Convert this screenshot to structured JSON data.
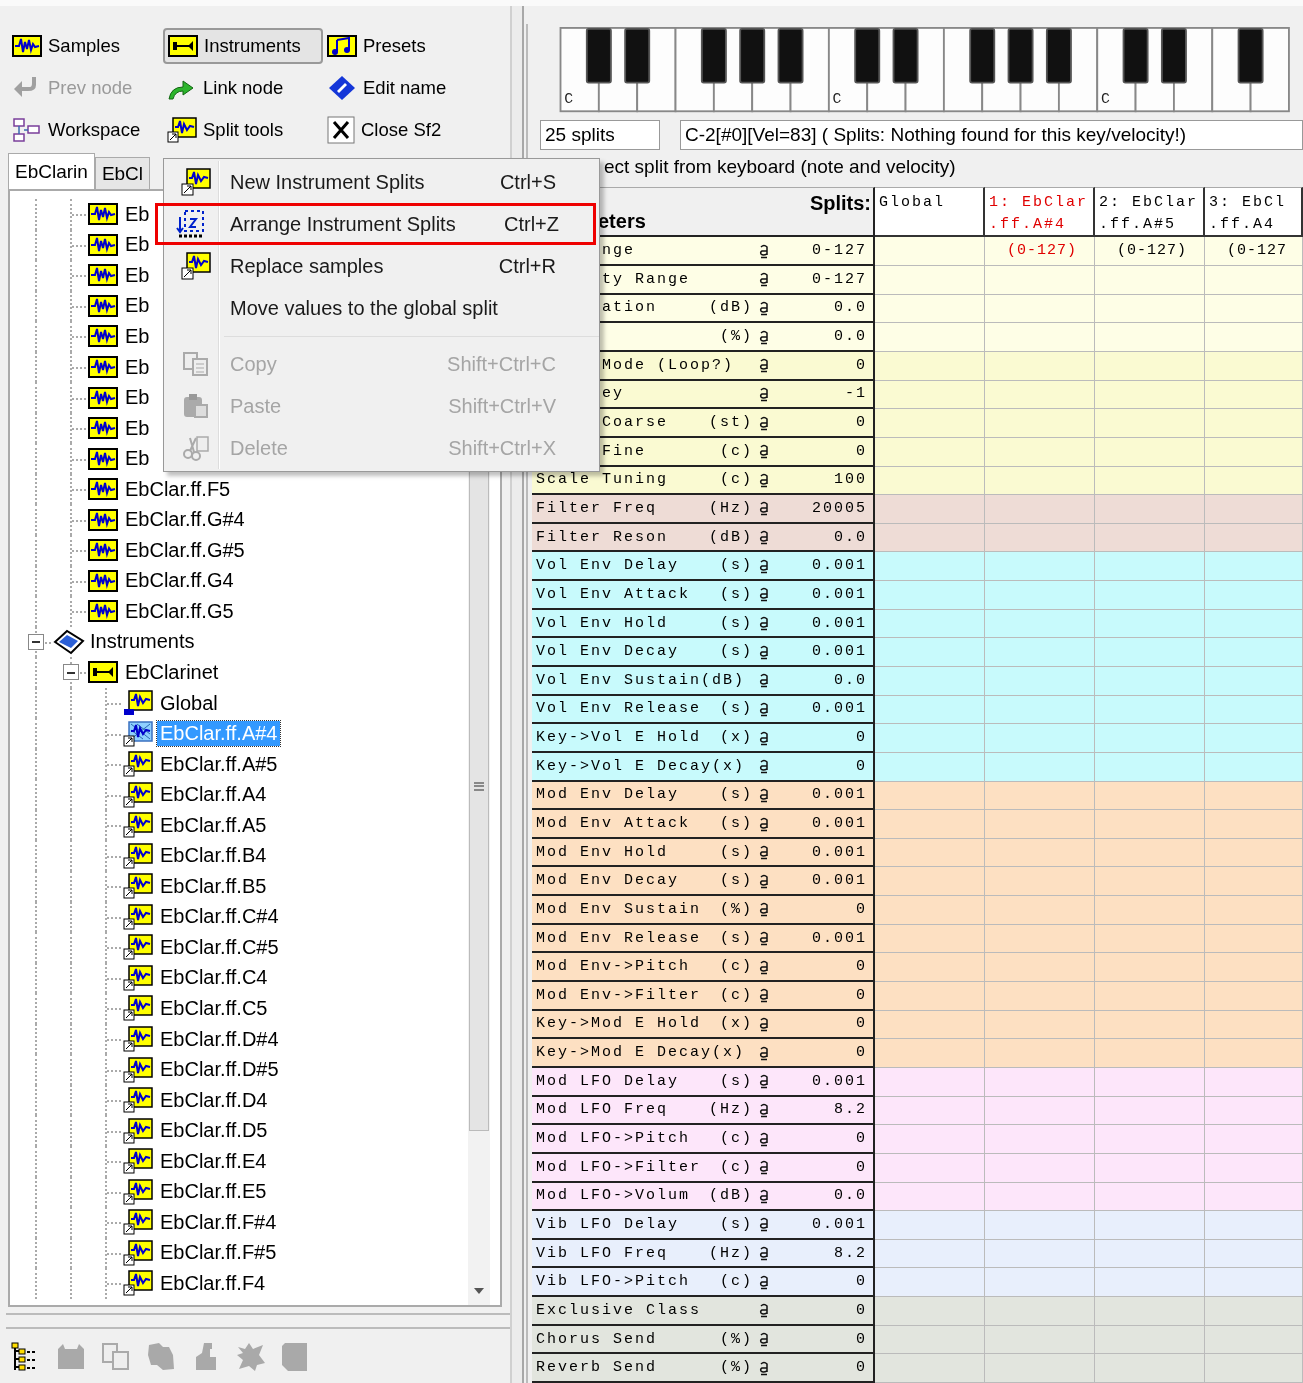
{
  "toolbar": [
    {
      "label": "Samples",
      "kind": "samples",
      "selected": false,
      "disabled": false
    },
    {
      "label": "Instruments",
      "kind": "instruments",
      "selected": true,
      "disabled": false
    },
    {
      "label": "Presets",
      "kind": "presets",
      "selected": false,
      "disabled": false
    },
    {
      "label": "Prev node",
      "kind": "prev",
      "selected": false,
      "disabled": true
    },
    {
      "label": "Link node",
      "kind": "link",
      "selected": false,
      "disabled": false
    },
    {
      "label": "Edit name",
      "kind": "edit",
      "selected": false,
      "disabled": false
    },
    {
      "label": "Workspace",
      "kind": "workspace",
      "selected": false,
      "disabled": false
    },
    {
      "label": "Split tools",
      "kind": "splittools",
      "selected": false,
      "disabled": false
    },
    {
      "label": "Close Sf2",
      "kind": "close",
      "selected": false,
      "disabled": false
    }
  ],
  "tabs": [
    {
      "label": "EbClarin",
      "selected": true
    },
    {
      "label": "EbCl",
      "selected": false
    }
  ],
  "tree": {
    "sample_rows": [
      {
        "label": "Eb",
        "kind": "sample",
        "selected": false
      },
      {
        "label": "Eb",
        "kind": "sample",
        "selected": false
      },
      {
        "label": "Eb",
        "kind": "sample",
        "selected": false
      },
      {
        "label": "Eb",
        "kind": "sample",
        "selected": false
      },
      {
        "label": "Eb",
        "kind": "sample",
        "selected": false
      },
      {
        "label": "Eb",
        "kind": "sample",
        "selected": false
      },
      {
        "label": "Eb",
        "kind": "sample",
        "selected": false
      },
      {
        "label": "Eb",
        "kind": "sample",
        "selected": false
      },
      {
        "label": "Eb",
        "kind": "sample",
        "selected": false
      },
      {
        "label": "EbClar.ff.F5",
        "kind": "sample",
        "selected": false
      },
      {
        "label": "EbClar.ff.G#4",
        "kind": "sample",
        "selected": false
      },
      {
        "label": "EbClar.ff.G#5",
        "kind": "sample",
        "selected": false
      },
      {
        "label": "EbClar.ff.G4",
        "kind": "sample",
        "selected": false
      },
      {
        "label": "EbClar.ff.G5",
        "kind": "sample",
        "selected": false
      }
    ],
    "nodes": [
      {
        "label": "Instruments",
        "kind": "instruments",
        "selected": false,
        "expanded": true,
        "children": [
          {
            "label": "EbClarinet",
            "kind": "instrument",
            "selected": false,
            "expanded": true,
            "children": [
              {
                "label": "Global",
                "kind": "global",
                "selected": false
              },
              {
                "label": "EbClar.ff.A#4",
                "kind": "split",
                "selected": true
              },
              {
                "label": "EbClar.ff.A#5",
                "kind": "split",
                "selected": false
              },
              {
                "label": "EbClar.ff.A4",
                "kind": "split",
                "selected": false
              },
              {
                "label": "EbClar.ff.A5",
                "kind": "split",
                "selected": false
              },
              {
                "label": "EbClar.ff.B4",
                "kind": "split",
                "selected": false
              },
              {
                "label": "EbClar.ff.B5",
                "kind": "split",
                "selected": false
              },
              {
                "label": "EbClar.ff.C#4",
                "kind": "split",
                "selected": false
              },
              {
                "label": "EbClar.ff.C#5",
                "kind": "split",
                "selected": false
              },
              {
                "label": "EbClar.ff.C4",
                "kind": "split",
                "selected": false
              },
              {
                "label": "EbClar.ff.C5",
                "kind": "split",
                "selected": false
              },
              {
                "label": "EbClar.ff.D#4",
                "kind": "split",
                "selected": false
              },
              {
                "label": "EbClar.ff.D#5",
                "kind": "split",
                "selected": false
              },
              {
                "label": "EbClar.ff.D4",
                "kind": "split",
                "selected": false
              },
              {
                "label": "EbClar.ff.D5",
                "kind": "split",
                "selected": false
              },
              {
                "label": "EbClar.ff.E4",
                "kind": "split",
                "selected": false
              },
              {
                "label": "EbClar.ff.E5",
                "kind": "split",
                "selected": false
              },
              {
                "label": "EbClar.ff.F#4",
                "kind": "split",
                "selected": false
              },
              {
                "label": "EbClar.ff.F#5",
                "kind": "split",
                "selected": false
              },
              {
                "label": "EbClar.ff.F4",
                "kind": "split",
                "selected": false
              }
            ]
          }
        ]
      }
    ]
  },
  "bottom_toolbar": [
    {
      "kind": "tree",
      "disabled": false
    },
    {
      "kind": "bin",
      "disabled": true
    },
    {
      "kind": "copy",
      "disabled": true
    },
    {
      "kind": "stack",
      "disabled": true
    },
    {
      "kind": "boot",
      "disabled": true
    },
    {
      "kind": "splat",
      "disabled": true
    },
    {
      "kind": "page",
      "disabled": true
    }
  ],
  "context_menu": {
    "items": [
      {
        "kind": "new-splits",
        "label": "New Instrument Splits",
        "shortcut": "Ctrl+S",
        "disabled": false,
        "highlighted": false
      },
      {
        "kind": "arrange",
        "label": "Arrange Instrument Splits",
        "shortcut": "Ctrl+Z",
        "disabled": false,
        "highlighted": true
      },
      {
        "kind": "replace",
        "label": "Replace samples",
        "shortcut": "Ctrl+R",
        "disabled": false,
        "highlighted": false
      },
      {
        "kind": "plain",
        "label": "Move values to the global split",
        "disabled": false,
        "highlighted": false
      },
      {
        "kind": "separator"
      },
      {
        "kind": "copy",
        "label": "Copy",
        "shortcut": "Shift+Ctrl+C",
        "disabled": true,
        "highlighted": false
      },
      {
        "kind": "paste",
        "label": "Paste",
        "shortcut": "Shift+Ctrl+V",
        "disabled": true,
        "highlighted": false
      },
      {
        "kind": "delete",
        "label": "Delete",
        "shortcut": "Shift+Ctrl+X",
        "disabled": true,
        "highlighted": false
      }
    ]
  },
  "keyboard": {
    "octave_labels": [
      "C",
      "C",
      "C"
    ]
  },
  "splits_count": "25 splits",
  "status": "C-2[#0][Vel=83] ( Splits: Nothing found for this key/velocity!)",
  "select_from_keyboard": "ect split from keyboard (note and velocity)",
  "table": {
    "param_header": "eters",
    "splits_label": "Splits:",
    "columns": [
      {
        "label": "Global",
        "selected": false
      },
      {
        "label": "1: EbClar",
        "sublabel": ".ff.A#4",
        "selected": true
      },
      {
        "label": "2: EbClar",
        "sublabel": ".ff.A#5",
        "selected": false
      },
      {
        "label": "3: EbCl",
        "sublabel": ".ff.A4",
        "selected": false
      }
    ],
    "rows": [
      {
        "name": "nge",
        "value": "0-127",
        "color": "#fefee6",
        "clipped": true,
        "splits": [
          "(0-127)",
          "(0-127)",
          "(0-127"
        ]
      },
      {
        "name": "ty Range",
        "value": "0-127",
        "color": "#fefee6",
        "clipped": true
      },
      {
        "name": "ation",
        "unit": "(dB)",
        "value": "0.0",
        "color": "#fefee6",
        "clipped": true
      },
      {
        "unit": "(%)",
        "value": "0.0",
        "color": "#fefee6"
      },
      {
        "name": "Mode (Loop?)",
        "value": "0",
        "color": "#fafad2",
        "clipped": true
      },
      {
        "name": "ey",
        "value": "-1",
        "color": "#fafad2",
        "clipped": true
      },
      {
        "name": "Coarse",
        "unit": "(st)",
        "value": "0",
        "color": "#fafad2",
        "clipped": true
      },
      {
        "name": "Fine",
        "unit": "(c)",
        "value": "0",
        "color": "#fafad2",
        "clipped": true
      },
      {
        "name": "Scale Tuning",
        "unit": "(c)",
        "value": "100",
        "color": "#fafad2",
        "clipped": false
      },
      {
        "name": "Filter Freq",
        "unit": "(Hz)",
        "value": "20005",
        "color": "#eedcd6",
        "clipped": false
      },
      {
        "name": "Filter Reson",
        "unit": "(dB)",
        "value": "0.0",
        "color": "#eedcd6",
        "clipped": false
      },
      {
        "name": "Vol Env Delay",
        "unit": "(s)",
        "value": "0.001",
        "color": "#c8fafc",
        "clipped": false
      },
      {
        "name": "Vol Env Attack",
        "unit": "(s)",
        "value": "0.001",
        "color": "#c8fafc",
        "clipped": false
      },
      {
        "name": "Vol Env Hold",
        "unit": "(s)",
        "value": "0.001",
        "color": "#c8fafc",
        "clipped": false
      },
      {
        "name": "Vol Env Decay",
        "unit": "(s)",
        "value": "0.001",
        "color": "#c8fafc",
        "clipped": false
      },
      {
        "name": "Vol Env Sustain(dB)",
        "value": "0.0",
        "color": "#c8fafc",
        "clipped": false
      },
      {
        "name": "Vol Env Release",
        "unit": "(s)",
        "value": "0.001",
        "color": "#c8fafc",
        "clipped": false
      },
      {
        "name": "Key->Vol E Hold",
        "unit": "(x)",
        "value": "0",
        "color": "#c8fafc",
        "clipped": false
      },
      {
        "name": "Key->Vol E Decay(x)",
        "value": "0",
        "color": "#c8fafc",
        "clipped": false
      },
      {
        "name": "Mod Env Delay",
        "unit": "(s)",
        "value": "0.001",
        "color": "#fde0c2",
        "clipped": false
      },
      {
        "name": "Mod Env Attack",
        "unit": "(s)",
        "value": "0.001",
        "color": "#fde0c2",
        "clipped": false
      },
      {
        "name": "Mod Env Hold",
        "unit": "(s)",
        "value": "0.001",
        "color": "#fde0c2",
        "clipped": false
      },
      {
        "name": "Mod Env Decay",
        "unit": "(s)",
        "value": "0.001",
        "color": "#fde0c2",
        "clipped": false
      },
      {
        "name": "Mod Env Sustain",
        "unit": "(%)",
        "value": "0",
        "color": "#fde0c2",
        "clipped": false
      },
      {
        "name": "Mod Env Release",
        "unit": "(s)",
        "value": "0.001",
        "color": "#fde0c2",
        "clipped": false
      },
      {
        "name": "Mod Env->Pitch",
        "unit": "(c)",
        "value": "0",
        "color": "#fde0c2",
        "clipped": false
      },
      {
        "name": "Mod Env->Filter",
        "unit": "(c)",
        "value": "0",
        "color": "#fde0c2",
        "clipped": false
      },
      {
        "name": "Key->Mod E Hold",
        "unit": "(x)",
        "value": "0",
        "color": "#fde0c2",
        "clipped": false
      },
      {
        "name": "Key->Mod E Decay(x)",
        "value": "0",
        "color": "#fde0c2",
        "clipped": false
      },
      {
        "name": "Mod LFO Delay",
        "unit": "(s)",
        "value": "0.001",
        "color": "#fde6fa",
        "clipped": false
      },
      {
        "name": "Mod LFO Freq",
        "unit": "(Hz)",
        "value": "8.2",
        "color": "#fde6fa",
        "clipped": false
      },
      {
        "name": "Mod LFO->Pitch",
        "unit": "(c)",
        "value": "0",
        "color": "#fde6fa",
        "clipped": false
      },
      {
        "name": "Mod LFO->Filter",
        "unit": "(c)",
        "value": "0",
        "color": "#fde6fa",
        "clipped": false
      },
      {
        "name": "Mod LFO->Volum",
        "unit": "(dB)",
        "value": "0.0",
        "color": "#fde6fa",
        "clipped": false
      },
      {
        "name": "Vib LFO Delay",
        "unit": "(s)",
        "value": "0.001",
        "color": "#e8effc",
        "clipped": false
      },
      {
        "name": "Vib LFO Freq",
        "unit": "(Hz)",
        "value": "8.2",
        "color": "#e8effc",
        "clipped": false
      },
      {
        "name": "Vib LFO->Pitch",
        "unit": "(c)",
        "value": "0",
        "color": "#e8effc",
        "clipped": false
      },
      {
        "name": "Exclusive Class",
        "value": "0",
        "color": "#e2e5de",
        "clipped": false
      },
      {
        "name": "Chorus Send",
        "unit": "(%)",
        "value": "0",
        "color": "#e2e5de",
        "clipped": false
      },
      {
        "name": "Reverb Send",
        "unit": "(%)",
        "value": "0",
        "color": "#e2e5de",
        "clipped": false
      }
    ]
  }
}
